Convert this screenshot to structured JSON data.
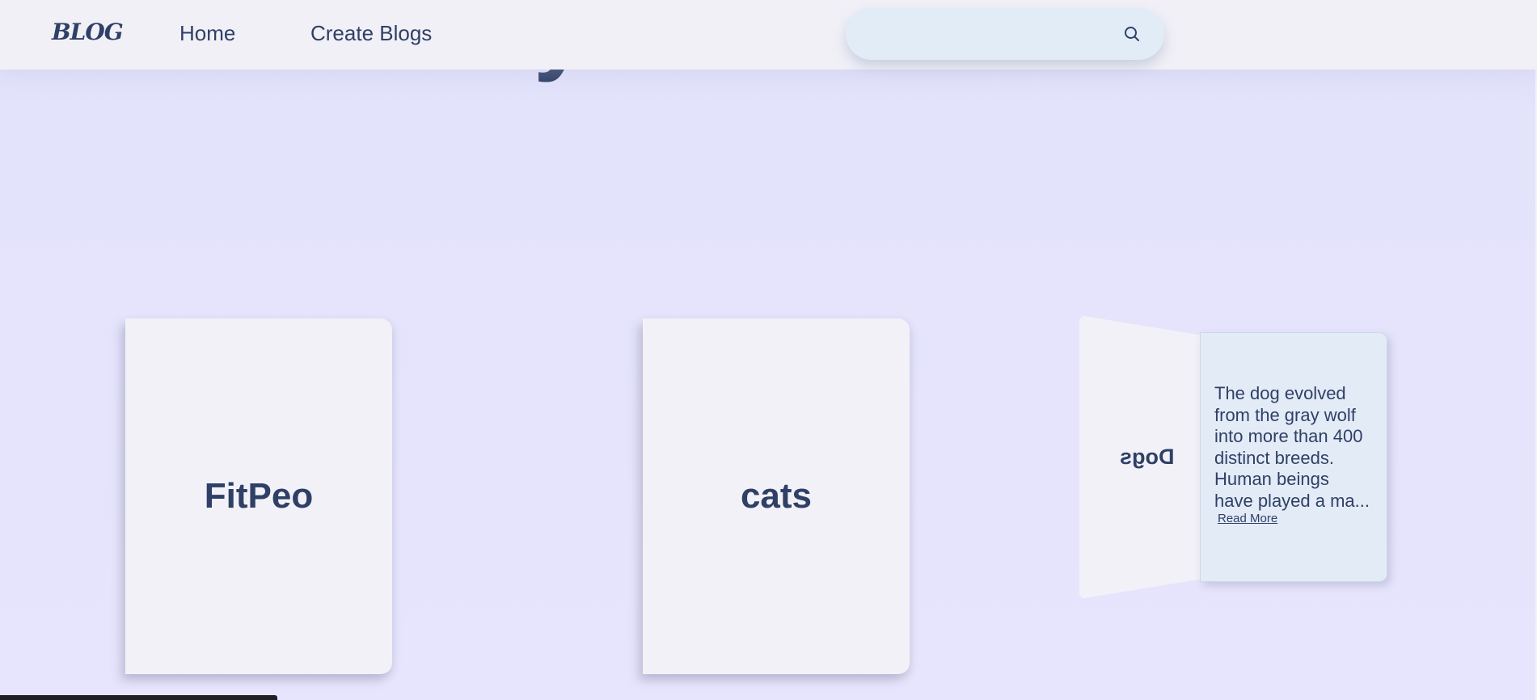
{
  "navbar": {
    "logo": "BLOG",
    "links": [
      {
        "label": "Home"
      },
      {
        "label": "Create Blogs"
      }
    ],
    "search": {
      "value": "",
      "placeholder": "",
      "icon": "search-icon"
    }
  },
  "hero": {
    "visible_fragment": "y"
  },
  "cards": [
    {
      "title": "FitPeo"
    },
    {
      "title": "cats"
    }
  ],
  "open_card": {
    "title": "Dogs",
    "excerpt": "The dog evolved from the gray wolf into more than 400 distinct breeds. Human beings have played a ma...",
    "read_more": "Read More"
  },
  "colors": {
    "text": "#2f4066",
    "background": "#e6e4fd",
    "card": "#f2f1f7",
    "card_inner": "#e3ebf7",
    "search": "#e2ecf7"
  }
}
